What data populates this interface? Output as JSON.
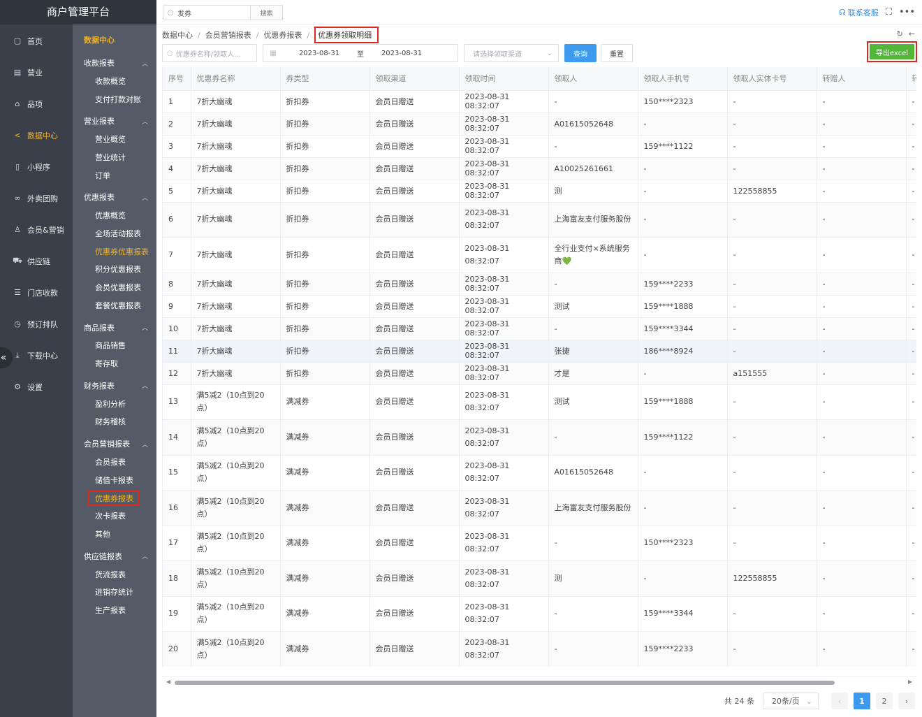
{
  "brand": "商户管理平台",
  "nav1": [
    {
      "label": "首页",
      "icon": "home-icon",
      "glyph": "▢"
    },
    {
      "label": "营业",
      "icon": "business-icon",
      "glyph": "▤"
    },
    {
      "label": "品项",
      "icon": "bag-icon",
      "glyph": "⌂"
    },
    {
      "label": "数据中心",
      "icon": "share-icon",
      "glyph": "<",
      "active": true
    },
    {
      "label": "小程序",
      "icon": "phone-icon",
      "glyph": "▯"
    },
    {
      "label": "外卖团购",
      "icon": "bike-icon",
      "glyph": "∞"
    },
    {
      "label": "会员&营销",
      "icon": "user-icon",
      "glyph": "♙"
    },
    {
      "label": "供应链",
      "icon": "truck-icon",
      "glyph": "⛟"
    },
    {
      "label": "门店收款",
      "icon": "database-icon",
      "glyph": "☰"
    },
    {
      "label": "预订排队",
      "icon": "clock-icon",
      "glyph": "◷"
    },
    {
      "label": "下载中心",
      "icon": "download-icon",
      "glyph": "⤓"
    },
    {
      "label": "设置",
      "icon": "gear-icon",
      "glyph": "⚙"
    }
  ],
  "nav2": {
    "title": "数据中心",
    "groups": [
      {
        "label": "收款报表",
        "items": [
          "收款概览",
          "支付打款对账"
        ]
      },
      {
        "label": "营业报表",
        "items": [
          "营业概览",
          "营业统计",
          "订单"
        ]
      },
      {
        "label": "优惠报表",
        "items": [
          "优惠概览",
          "全场活动报表",
          "优惠券优惠报表",
          "积分优惠报表",
          "会员优惠报表",
          "套餐优惠报表"
        ]
      },
      {
        "label": "商品报表",
        "items": [
          "商品销售",
          "寄存取"
        ]
      },
      {
        "label": "财务报表",
        "items": [
          "盈利分析",
          "财务稽核"
        ]
      },
      {
        "label": "会员营销报表",
        "items": [
          "会员报表",
          "储值卡报表",
          "优惠券报表",
          "次卡报表",
          "其他"
        ]
      },
      {
        "label": "供应链报表",
        "items": [
          "货流报表",
          "进销存统计",
          "生产报表"
        ]
      }
    ]
  },
  "topbar": {
    "search_value": "发券",
    "search_button": "搜索",
    "contact": "联系客服"
  },
  "breadcrumb": [
    "数据中心",
    "会员营销报表",
    "优惠券报表",
    "优惠券领取明细"
  ],
  "filters": {
    "name_placeholder": "优惠券名称/领取人...",
    "date_start": "2023-08-31",
    "date_to": "至",
    "date_end": "2023-08-31",
    "channel_placeholder": "请选择领取渠道",
    "query": "查询",
    "reset": "重置",
    "export": "导出excel"
  },
  "table": {
    "columns": [
      "序号",
      "优惠券名称",
      "券类型",
      "领取渠道",
      "领取时间",
      "领取人",
      "领取人手机号",
      "领取人实体卡号",
      "转赠人",
      "转"
    ],
    "rows": [
      [
        "1",
        "7折大幽魂",
        "折扣券",
        "会员日赠送",
        "2023-08-31 08:32:07",
        "-",
        "150****2323",
        "-",
        "-",
        "-"
      ],
      [
        "2",
        "7折大幽魂",
        "折扣券",
        "会员日赠送",
        "2023-08-31 08:32:07",
        "A01615052648",
        "-",
        "-",
        "-",
        "-"
      ],
      [
        "3",
        "7折大幽魂",
        "折扣券",
        "会员日赠送",
        "2023-08-31 08:32:07",
        "-",
        "159****1122",
        "-",
        "-",
        "-"
      ],
      [
        "4",
        "7折大幽魂",
        "折扣券",
        "会员日赠送",
        "2023-08-31 08:32:07",
        "A10025261661",
        "-",
        "-",
        "-",
        "-"
      ],
      [
        "5",
        "7折大幽魂",
        "折扣券",
        "会员日赠送",
        "2023-08-31 08:32:07",
        "测",
        "-",
        "122558855",
        "-",
        "-"
      ],
      [
        "6",
        "7折大幽魂",
        "折扣券",
        "会员日赠送",
        "2023-08-31 08:32:07",
        "上海富友支付服务股份",
        "-",
        "-",
        "-",
        "-"
      ],
      [
        "7",
        "7折大幽魂",
        "折扣券",
        "会员日赠送",
        "2023-08-31 08:32:07",
        "全行业支付×系统服务商💚",
        "-",
        "-",
        "-",
        "-"
      ],
      [
        "8",
        "7折大幽魂",
        "折扣券",
        "会员日赠送",
        "2023-08-31 08:32:07",
        "-",
        "159****2233",
        "-",
        "-",
        "-"
      ],
      [
        "9",
        "7折大幽魂",
        "折扣券",
        "会员日赠送",
        "2023-08-31 08:32:07",
        "测试",
        "159****1888",
        "-",
        "-",
        "-"
      ],
      [
        "10",
        "7折大幽魂",
        "折扣券",
        "会员日赠送",
        "2023-08-31 08:32:07",
        "-",
        "159****3344",
        "-",
        "-",
        "-"
      ],
      [
        "11",
        "7折大幽魂",
        "折扣券",
        "会员日赠送",
        "2023-08-31 08:32:07",
        "张捷",
        "186****8924",
        "-",
        "-",
        "-"
      ],
      [
        "12",
        "7折大幽魂",
        "折扣券",
        "会员日赠送",
        "2023-08-31 08:32:07",
        "才是",
        "-",
        "a151555",
        "-",
        "-"
      ],
      [
        "13",
        "满5减2（10点到20点）",
        "满减券",
        "会员日赠送",
        "2023-08-31 08:32:07",
        "测试",
        "159****1888",
        "-",
        "-",
        "-"
      ],
      [
        "14",
        "满5减2（10点到20点）",
        "满减券",
        "会员日赠送",
        "2023-08-31 08:32:07",
        "-",
        "159****1122",
        "-",
        "-",
        "-"
      ],
      [
        "15",
        "满5减2（10点到20点）",
        "满减券",
        "会员日赠送",
        "2023-08-31 08:32:07",
        "A01615052648",
        "-",
        "-",
        "-",
        "-"
      ],
      [
        "16",
        "满5减2（10点到20点）",
        "满减券",
        "会员日赠送",
        "2023-08-31 08:32:07",
        "上海富友支付服务股份",
        "-",
        "-",
        "-",
        "-"
      ],
      [
        "17",
        "满5减2（10点到20点）",
        "满减券",
        "会员日赠送",
        "2023-08-31 08:32:07",
        "-",
        "150****2323",
        "-",
        "-",
        "-"
      ],
      [
        "18",
        "满5减2（10点到20点）",
        "满减券",
        "会员日赠送",
        "2023-08-31 08:32:07",
        "测",
        "-",
        "122558855",
        "-",
        "-"
      ],
      [
        "19",
        "满5减2（10点到20点）",
        "满减券",
        "会员日赠送",
        "2023-08-31 08:32:07",
        "-",
        "159****3344",
        "-",
        "-",
        "-"
      ],
      [
        "20",
        "满5减2（10点到20点）",
        "满减券",
        "会员日赠送",
        "2023-08-31 08:32:07",
        "-",
        "159****2233",
        "-",
        "-",
        "-"
      ]
    ]
  },
  "pagination": {
    "total": "共 24 条",
    "page_size": "20条/页",
    "pages": [
      "1",
      "2"
    ],
    "current": "1"
  },
  "colors": {
    "accent": "#3d9aee",
    "export": "#52b637",
    "active_nav": "#f5b21f",
    "highlight_box": "#e0271f"
  }
}
